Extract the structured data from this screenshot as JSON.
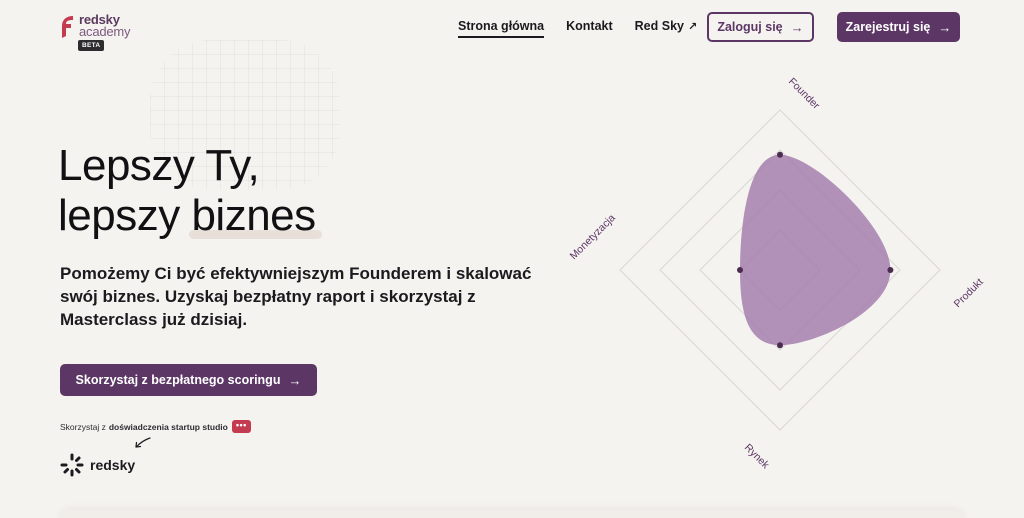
{
  "brand": {
    "line1": "redsky",
    "line2": "academy",
    "badge": "BETA",
    "accent": "#5c3766",
    "logo_red": "#c43a4f"
  },
  "nav": {
    "items": [
      {
        "label": "Strona główna",
        "active": true
      },
      {
        "label": "Kontakt",
        "active": false
      },
      {
        "label": "Red Sky",
        "active": false,
        "icon": "external-arrow-icon"
      }
    ],
    "login_label": "Zaloguj się",
    "register_label": "Zarejestruj się"
  },
  "hero": {
    "title_line1": "Lepszy Ty,",
    "title_line2_a": "lepszy",
    "title_line2_b": "biznes",
    "lead": "Pomożemy Ci być efektywniejszym Founderem i skalować swój biznes. Uzyskaj bezpłatny raport i skorzystaj z Masterclass już dzisiaj.",
    "cta_label": "Skorzystaj z bezpłatnego scoringu",
    "note_prefix": "Skorzystaj z",
    "note_bold": "doświadczenia startup studio",
    "note_badge": "•••",
    "partner_name": "redsky"
  },
  "radar": {
    "axes": [
      {
        "label": "Founder",
        "value": 0.72
      },
      {
        "label": "Produkt",
        "value": 0.69
      },
      {
        "label": "Rynek",
        "value": 0.47
      },
      {
        "label": "Monetyzacja",
        "value": 0.25
      }
    ],
    "fill_color": "#a57fae",
    "grid_color": "#d9d6d2"
  }
}
